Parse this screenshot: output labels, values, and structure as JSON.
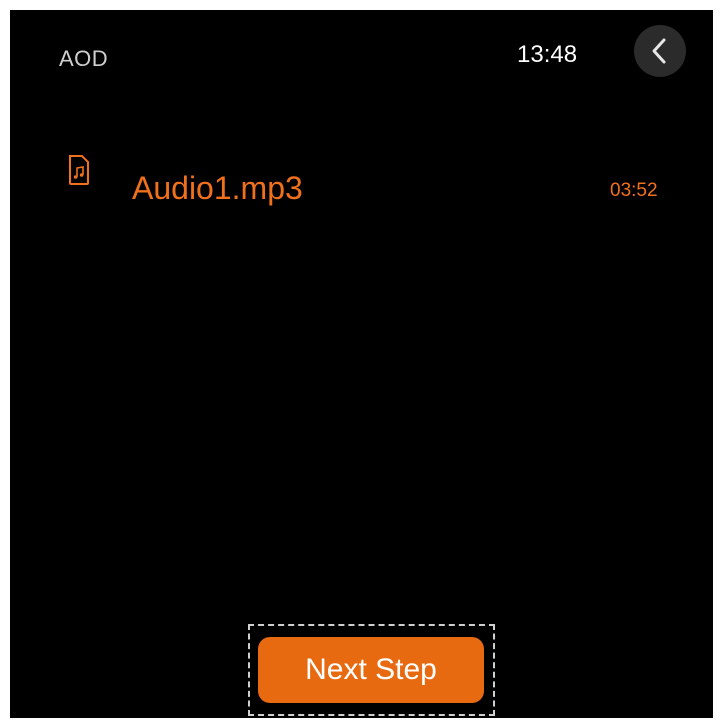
{
  "header": {
    "title": "AOD",
    "time": "13:48",
    "back_icon": "chevron-left-icon"
  },
  "files": [
    {
      "icon": "music-file-icon",
      "name": "Audio1.mp3",
      "duration": "03:52"
    }
  ],
  "footer": {
    "next_label": "Next Step"
  },
  "colors": {
    "accent": "#e86a10",
    "text_accent": "#f0701c",
    "background": "#000000"
  }
}
